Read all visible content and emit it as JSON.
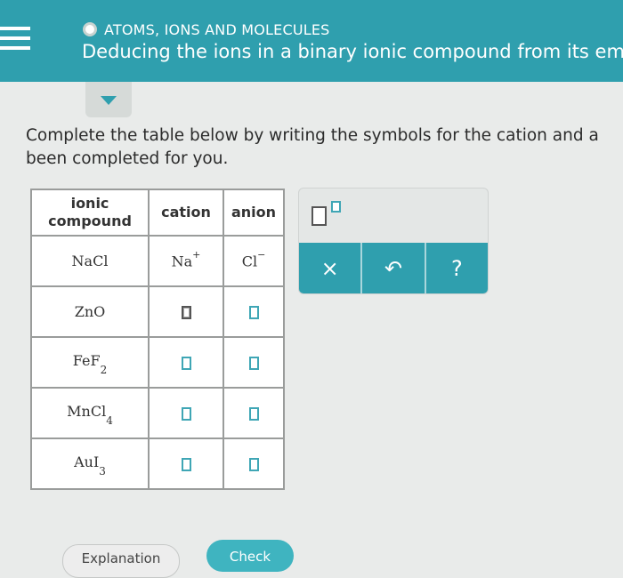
{
  "header": {
    "topic": "ATOMS, IONS AND MOLECULES",
    "title": "Deducing the ions in a binary ionic compound from its empi"
  },
  "instructions": [
    "Complete the table below by writing the symbols for the cation and a",
    "been completed for you."
  ],
  "table": {
    "headers": {
      "compound_line1": "ionic",
      "compound_line2": "compound",
      "cation": "cation",
      "anion": "anion"
    },
    "rows": [
      {
        "formula": "NaCl",
        "subscript": "",
        "cation": "Na",
        "cation_charge": "+",
        "anion": "Cl",
        "anion_charge": "−"
      },
      {
        "formula": "ZnO",
        "subscript": ""
      },
      {
        "formula": "FeF",
        "subscript": "2"
      },
      {
        "formula": "MnCl",
        "subscript": "4"
      },
      {
        "formula": "AuI",
        "subscript": "3"
      }
    ]
  },
  "palette": {
    "template_icon": "superscript-template-icon",
    "buttons": [
      {
        "label": "×",
        "icon": "clear-icon"
      },
      {
        "label": "↶",
        "icon": "undo-icon"
      },
      {
        "label": "?",
        "icon": "help-icon"
      }
    ]
  },
  "footer": {
    "explanation_label": "Explanation",
    "check_label": "Check"
  },
  "colors": {
    "accent": "#2f9fae",
    "check_button": "#3fb4c0",
    "input_box": "#3fa6b5"
  }
}
